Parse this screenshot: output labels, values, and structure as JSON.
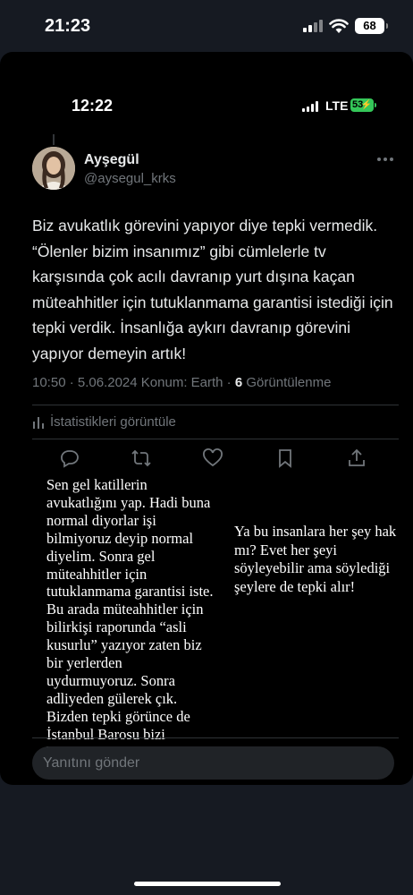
{
  "outer_status": {
    "time": "21:23",
    "battery": "68"
  },
  "inner_status": {
    "time": "12:22",
    "network": "LTE",
    "battery": "53"
  },
  "tweet": {
    "display_name": "Ayşegül",
    "handle": "@aysegul_krks",
    "text": "Biz avukatlık görevini yapıyor diye tepki vermedik. “Ölenler bizim insanımız” gibi cümlelerle tv karşısında çok acılı davranıp yurt dışına kaçan müteahhitler için tutuklanmama garantisi istediği için tepki verdik. İnsanlığa aykırı davranıp görevini yapıyor demeyin artık!",
    "time": "10:50",
    "date": "5.06.2024",
    "location": "Konum: Earth",
    "views_count": "6",
    "views_label": "Görüntülenme",
    "stats_link": "İstatistikleri görüntüle"
  },
  "overlay": {
    "left": "Sen gel katillerin avukatlığını yap. Hadi buna normal diyorlar işi bilmiyoruz deyip normal diyelim. Sonra gel müteahhitler için tutuklanmama garantisi iste. Bu arada müteahhitler için bilirkişi raporunda “asli kusurlu” yazıyor zaten biz bir yerlerden uydurmuyoruz. Sonra adliyeden gülerek çık. Bizden tepki görünce de İstanbul Barosu bizi kınasın!",
    "right": "Ya bu insanlara her şey hak mı? Evet her şeyi söyleyebilir ama söylediği şeylere de tepki alır!"
  },
  "composer": {
    "placeholder": "Yanıtını gönder"
  },
  "icons": {
    "reply": "reply-icon",
    "retweet": "retweet-icon",
    "like": "heart-icon",
    "bookmark": "bookmark-icon",
    "share": "share-icon",
    "stats": "bar-chart-icon"
  },
  "colors": {
    "background": "#000000",
    "text": "#e7e9ea",
    "secondary_text": "#71767b",
    "battery_green": "#34c759"
  }
}
